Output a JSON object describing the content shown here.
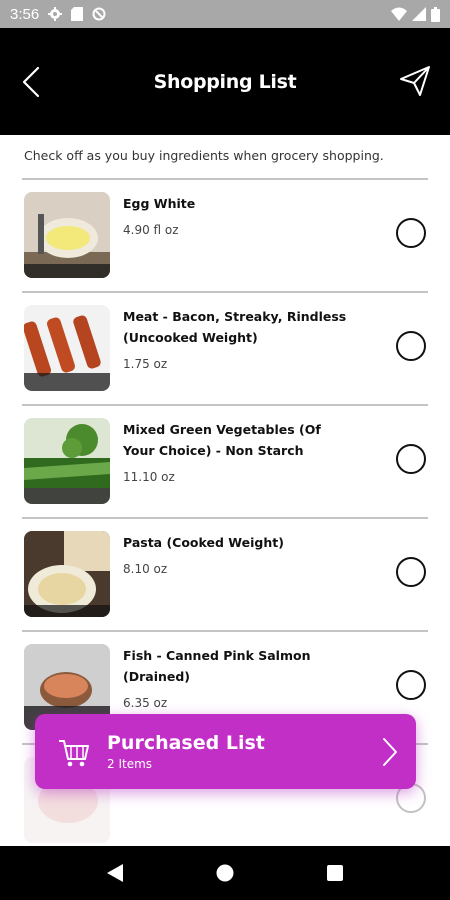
{
  "status_bar": {
    "time": "3:56",
    "icons": [
      "gear-icon",
      "sd-card-icon",
      "sync-icon"
    ],
    "right_icons": [
      "wifi-icon",
      "signal-icon",
      "battery-icon"
    ]
  },
  "header": {
    "title": "Shopping List",
    "back_icon": "back-chevron-icon",
    "send_icon": "paper-plane-icon"
  },
  "subtitle": "Check off as you buy ingredients when grocery shopping.",
  "items": [
    {
      "name": "Egg White",
      "qty": "4.90 fl oz",
      "thumb": "egg-white-image",
      "checked": false
    },
    {
      "name": "Meat - Bacon, Streaky, Rindless (Uncooked Weight)",
      "qty": "1.75 oz",
      "thumb": "bacon-image",
      "checked": false
    },
    {
      "name": "Mixed Green Vegetables (Of Your Choice) - Non Starch",
      "qty": "11.10 oz",
      "thumb": "vegetables-image",
      "checked": false
    },
    {
      "name": "Pasta (Cooked Weight)",
      "qty": "8.10 oz",
      "thumb": "pasta-image",
      "checked": false
    },
    {
      "name": "Fish - Canned Pink Salmon (Drained)",
      "qty": "6.35 oz",
      "thumb": "salmon-image",
      "checked": false
    },
    {
      "name": "",
      "qty": "",
      "thumb": "partial-image",
      "checked": false
    }
  ],
  "purchased": {
    "title": "Purchased List",
    "count": "2 Items",
    "icon": "cart-icon",
    "accent_color": "#c22fc6"
  },
  "nav": {
    "back": "nav-back-icon",
    "home": "nav-home-icon",
    "recents": "nav-recents-icon"
  }
}
